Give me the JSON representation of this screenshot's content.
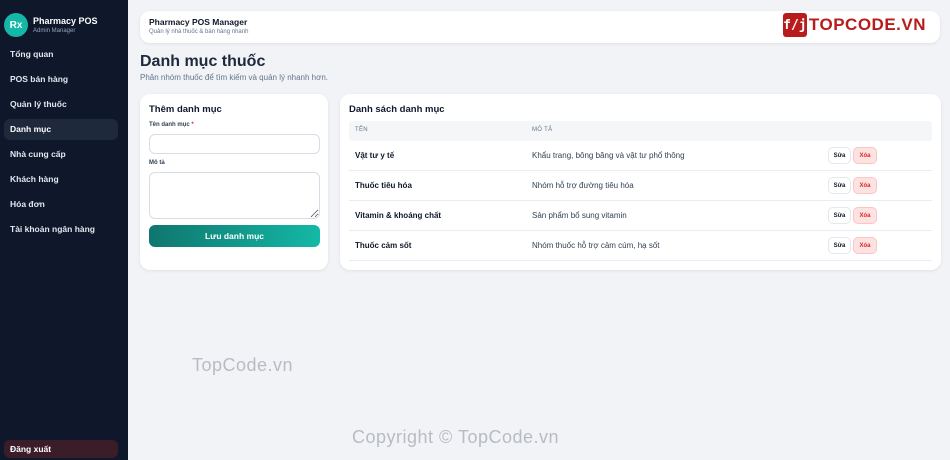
{
  "brand": {
    "logo_text": "Rx",
    "title": "Pharmacy POS",
    "subtitle": "Admin Manager"
  },
  "sidebar": {
    "items": [
      {
        "label": "Tổng quan"
      },
      {
        "label": "POS bán hàng"
      },
      {
        "label": "Quản lý thuốc"
      },
      {
        "label": "Danh mục",
        "active": true
      },
      {
        "label": "Nhà cung cấp"
      },
      {
        "label": "Khách hàng"
      },
      {
        "label": "Hóa đơn"
      },
      {
        "label": "Tài khoản ngân hàng"
      }
    ],
    "logout": "Đăng xuất"
  },
  "header": {
    "title": "Pharmacy POS Manager",
    "subtitle": "Quản lý nhà thuốc & bán hàng nhanh",
    "brand_logo_text": "TOPCODE.VN",
    "brand_icon": "f/j"
  },
  "page": {
    "title": "Danh mục thuốc",
    "subtitle": "Phân nhóm thuốc để tìm kiếm và quản lý nhanh hơn."
  },
  "form": {
    "title": "Thêm danh mục",
    "name_label": "Tên danh mục",
    "required_mark": "*",
    "name_value": "",
    "desc_label": "Mô tả",
    "desc_value": "",
    "save_label": "Lưu danh mục"
  },
  "list": {
    "title": "Danh sách danh mục",
    "columns": [
      "TÊN",
      "MÔ TẢ"
    ],
    "rows": [
      {
        "name": "Vật tư y tế",
        "desc": "Khẩu trang, bông băng và vật tư phổ thông"
      },
      {
        "name": "Thuốc tiêu hóa",
        "desc": "Nhóm hỗ trợ đường tiêu hóa"
      },
      {
        "name": "Vitamin & khoáng chất",
        "desc": "Sản phẩm bổ sung vitamin"
      },
      {
        "name": "Thuốc cảm sốt",
        "desc": "Nhóm thuốc hỗ trợ cảm cúm, hạ sốt"
      }
    ],
    "edit_label": "Sửa",
    "delete_label": "Xóa"
  },
  "watermarks": {
    "top": "TopCode.vn",
    "bottom": "Copyright © TopCode.vn"
  },
  "colors": {
    "sidebar_bg": "#0f172a",
    "accent": "#14b8a6",
    "brand_red": "#b91c1c",
    "danger": "#dc2626"
  }
}
